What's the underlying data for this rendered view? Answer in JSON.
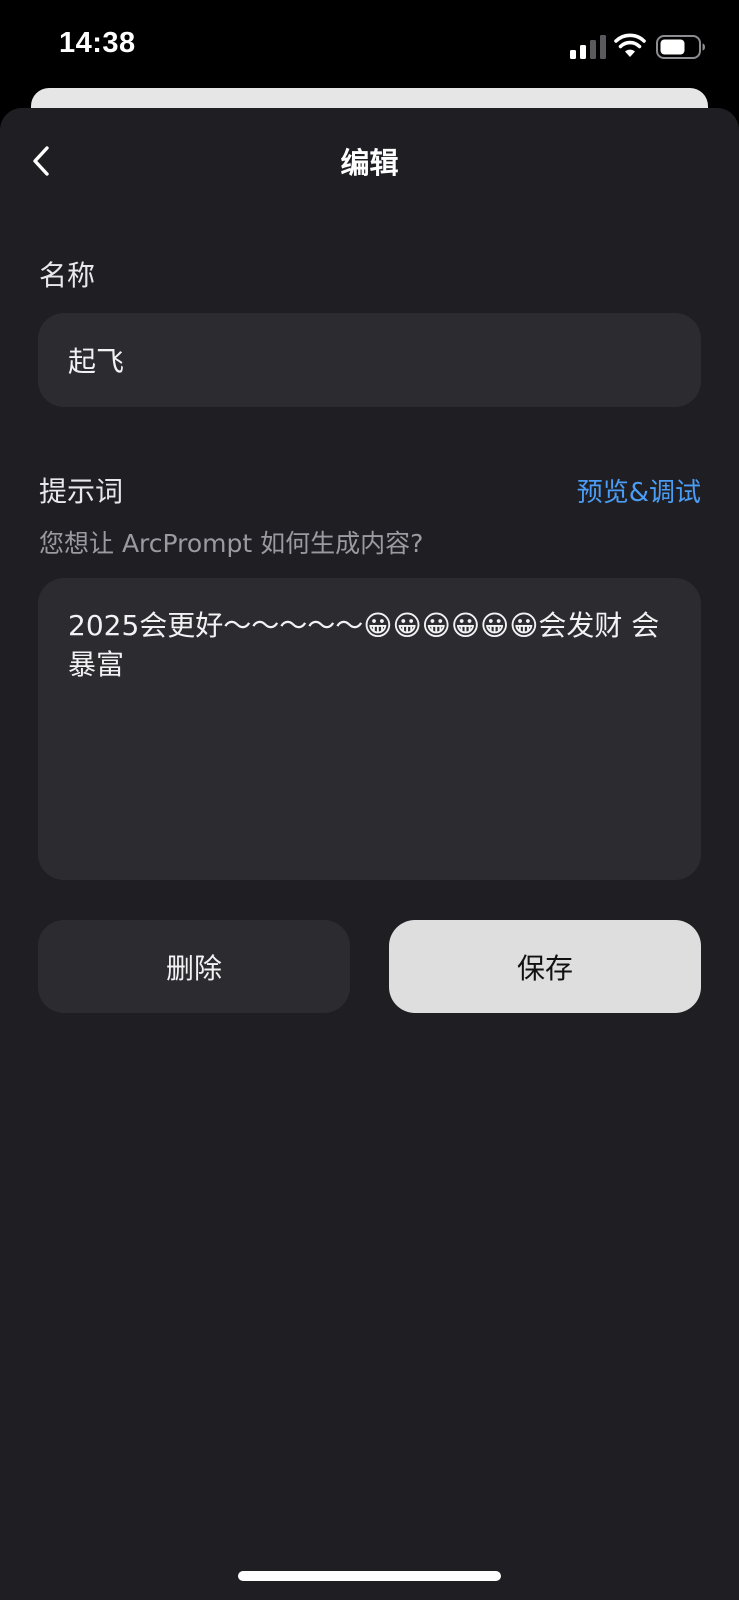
{
  "status_bar": {
    "time": "14:38"
  },
  "header": {
    "title": "编辑",
    "back_icon": "chevron-left-icon"
  },
  "name_field": {
    "label": "名称",
    "value": "起飞"
  },
  "prompt_field": {
    "label": "提示词",
    "preview_link": "预览&调试",
    "hint": "您想让 ArcPrompt 如何生成内容?",
    "value": "2025会更好～～～～～😀😀😀😀😀😀会发财 会暴富"
  },
  "actions": {
    "delete_label": "删除",
    "save_label": "保存"
  },
  "colors": {
    "sheet_background": "#1f1f23",
    "input_background": "#2c2c30",
    "accent_link": "#4a9cf5",
    "save_button": "#dedede"
  }
}
